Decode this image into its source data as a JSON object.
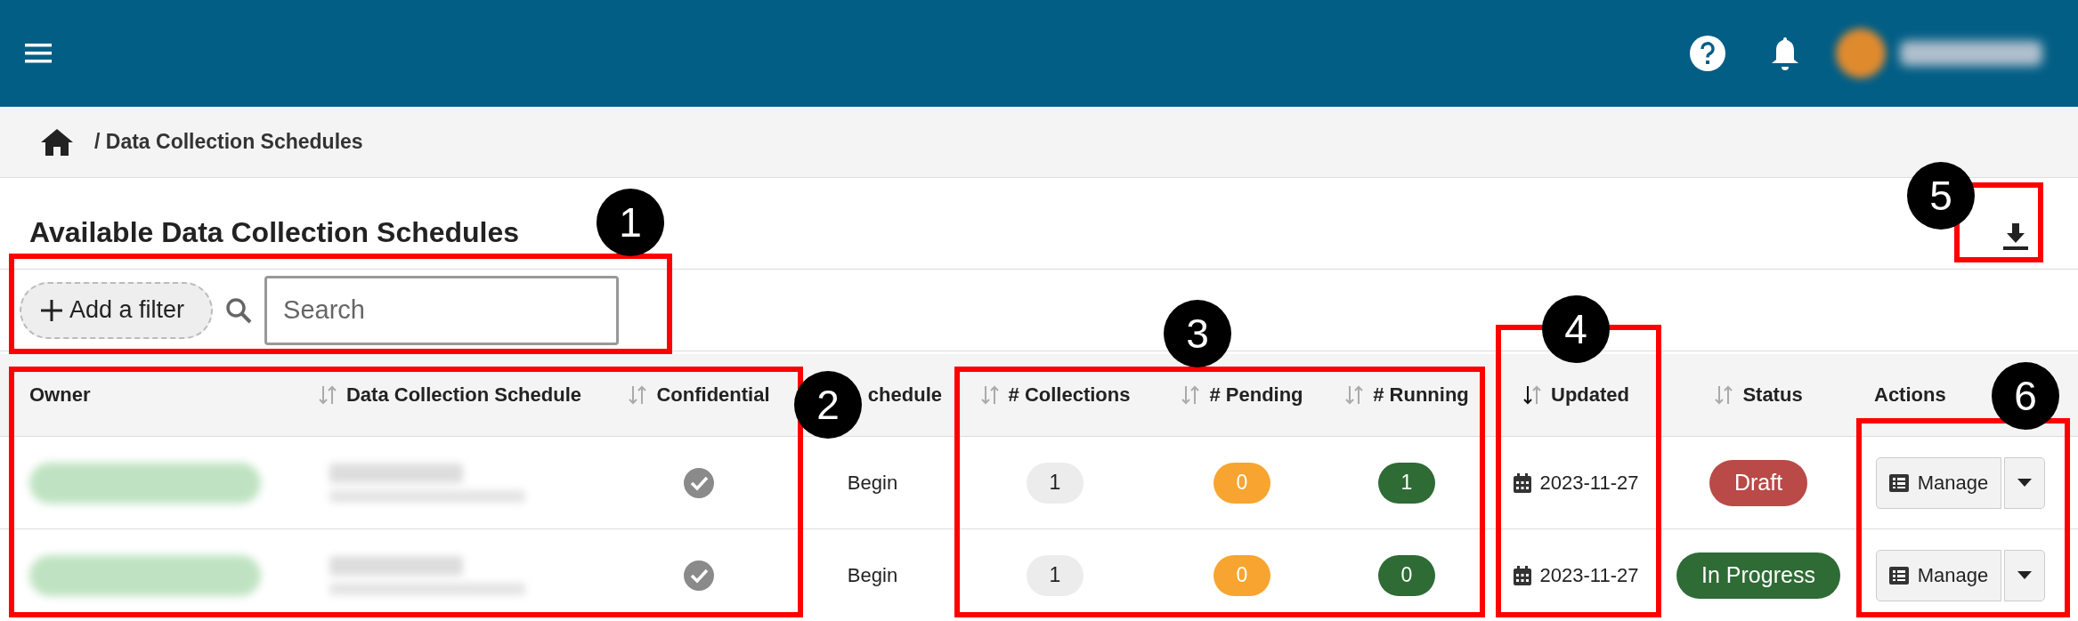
{
  "breadcrumb": {
    "current": "/ Data Collection Schedules"
  },
  "title": "Available Data Collection Schedules",
  "filter": {
    "add_label": "Add a filter",
    "search_placeholder": "Search"
  },
  "table": {
    "columns": [
      {
        "label": "Owner",
        "sortable": false
      },
      {
        "label": "Data Collection Schedule",
        "sortable": true,
        "sorted": false
      },
      {
        "label": "Confidential",
        "sortable": true,
        "sorted": false
      },
      {
        "label": "chedule",
        "sortable": false
      },
      {
        "label": "# Collections",
        "sortable": true,
        "sorted": false
      },
      {
        "label": "# Pending",
        "sortable": true,
        "sorted": false
      },
      {
        "label": "# Running",
        "sortable": true,
        "sorted": false
      },
      {
        "label": "Updated",
        "sortable": true,
        "sorted": true
      },
      {
        "label": "Status",
        "sortable": true,
        "sorted": false
      },
      {
        "label": "Actions",
        "sortable": false
      }
    ],
    "rows": [
      {
        "confidential": true,
        "schedule": "Begin",
        "collections": "1",
        "pending": "0",
        "running": "1",
        "updated": "2023-11-27",
        "status": {
          "label": "Draft",
          "color": "#b94a48"
        },
        "action": "Manage"
      },
      {
        "confidential": true,
        "schedule": "Begin",
        "collections": "1",
        "pending": "0",
        "running": "0",
        "updated": "2023-11-27",
        "status": {
          "label": "In Progress",
          "color": "#2e6b35"
        },
        "action": "Manage"
      }
    ]
  },
  "annotations": [
    {
      "label": "1"
    },
    {
      "label": "2"
    },
    {
      "label": "3"
    },
    {
      "label": "4"
    },
    {
      "label": "5"
    },
    {
      "label": "6"
    }
  ]
}
